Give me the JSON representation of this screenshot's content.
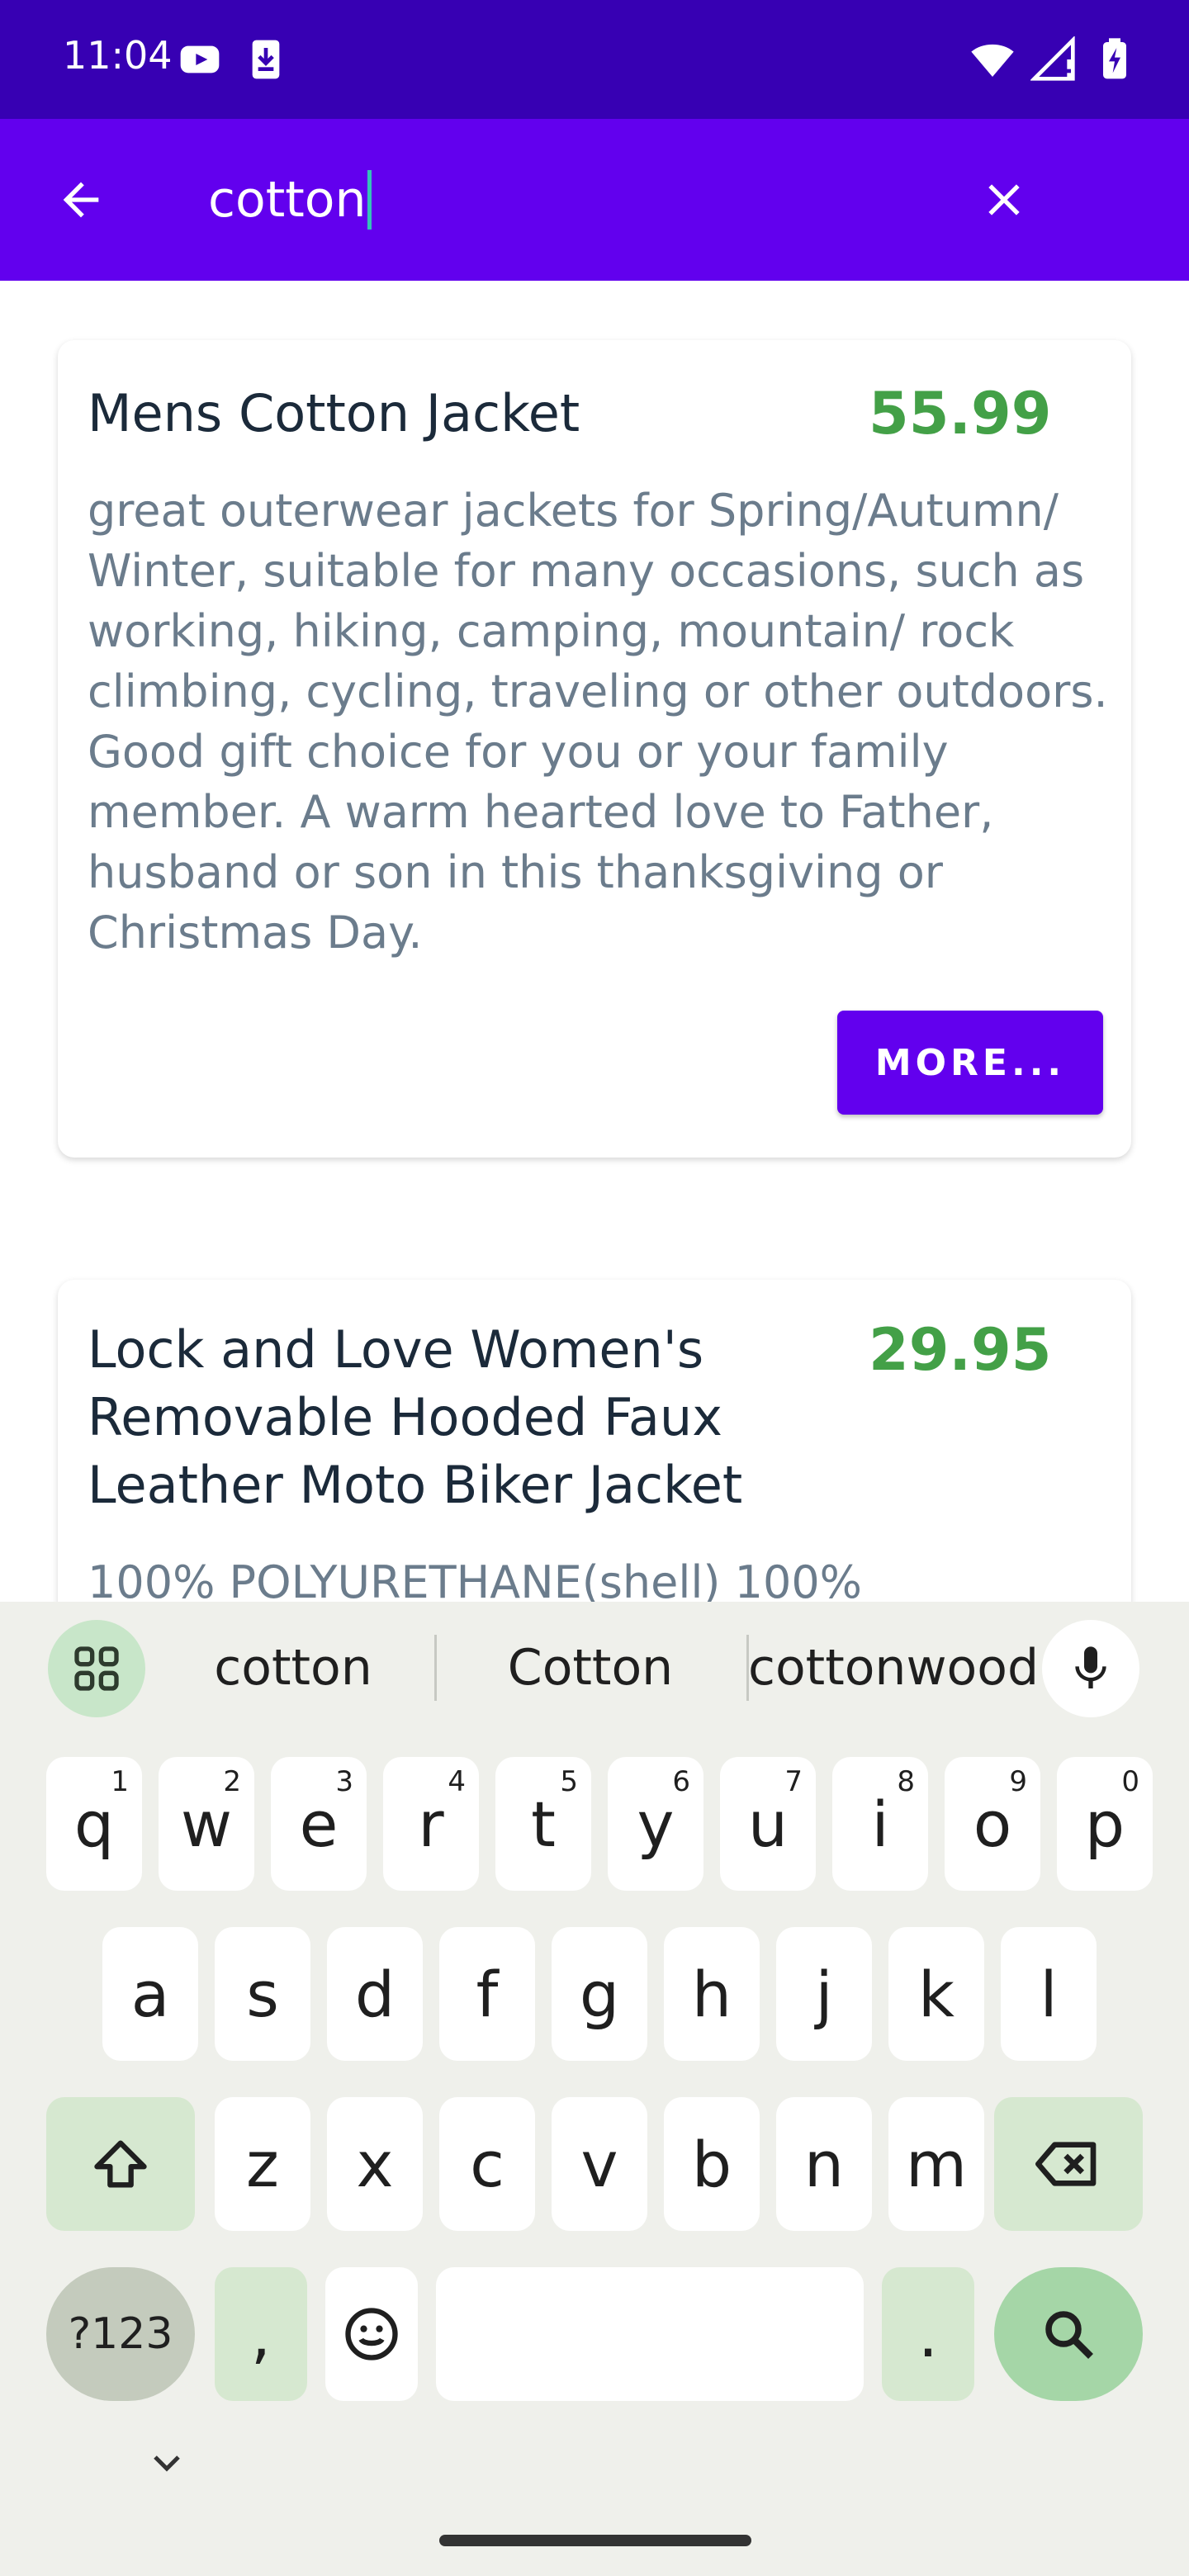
{
  "status_bar": {
    "time": "11:04",
    "icons_left": [
      "youtube-icon",
      "download-icon"
    ],
    "icons_right": [
      "wifi-icon",
      "signal-icon",
      "battery-charging-icon"
    ]
  },
  "search_bar": {
    "query": "cotton",
    "back_icon": "arrow-back-icon",
    "clear_icon": "close-icon"
  },
  "products": [
    {
      "title": "Mens Cotton Jacket",
      "price": "55.99",
      "description": "great outerwear jackets for Spring/Autumn/ Winter, suitable for many occasions, such as working, hiking, camping, mountain/ rock climbing, cycling, traveling or other outdoors. Good gift choice for you or your family member. A warm hearted love to Father, husband or son in this thanksgiving or Christmas Day.",
      "button": "MORE..."
    },
    {
      "title": "Lock and Love Women's Removable Hooded Faux Leather Moto Biker Jacket",
      "price": "29.95",
      "description": "100% POLYURETHANE(shell) 100%"
    }
  ],
  "keyboard": {
    "suggestions": [
      "cotton",
      "Cotton",
      "cottonwood"
    ],
    "row1": [
      {
        "k": "q",
        "h": "1"
      },
      {
        "k": "w",
        "h": "2"
      },
      {
        "k": "e",
        "h": "3"
      },
      {
        "k": "r",
        "h": "4"
      },
      {
        "k": "t",
        "h": "5"
      },
      {
        "k": "y",
        "h": "6"
      },
      {
        "k": "u",
        "h": "7"
      },
      {
        "k": "i",
        "h": "8"
      },
      {
        "k": "o",
        "h": "9"
      },
      {
        "k": "p",
        "h": "0"
      }
    ],
    "row2": [
      "a",
      "s",
      "d",
      "f",
      "g",
      "h",
      "j",
      "k",
      "l"
    ],
    "row3": [
      "z",
      "x",
      "c",
      "v",
      "b",
      "n",
      "m"
    ],
    "symbols_key": "?123",
    "comma_key": ",",
    "period_key": ".",
    "colors": {
      "accent": "#6200ee",
      "price": "#43a047",
      "status": "#3700b3"
    }
  }
}
